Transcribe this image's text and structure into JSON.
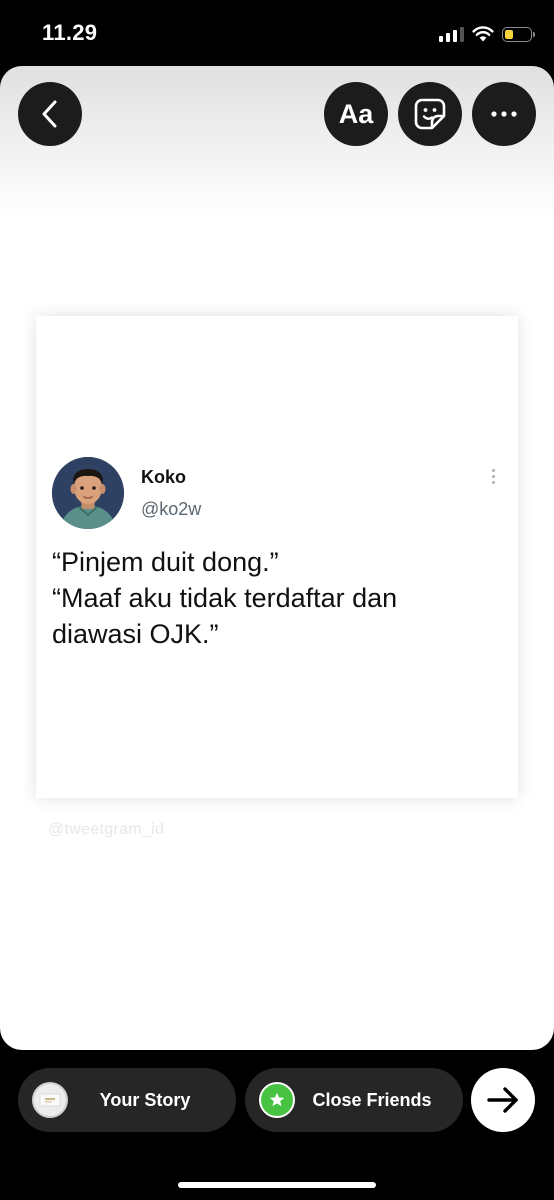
{
  "status_bar": {
    "time": "11.29",
    "signal_bars": 3,
    "signal_total": 4,
    "battery_level": 0.35,
    "battery_color": "#f5d33a"
  },
  "toolbar": {
    "back_icon": "chevron-left-icon",
    "text_label": "Aa",
    "sticker_icon": "sticker-icon",
    "more_icon": "more-horizontal-icon"
  },
  "tweet": {
    "name": "Koko",
    "handle": "@ko2w",
    "lines": [
      "“Pinjem duit dong.”",
      "“Maaf aku tidak terdaftar dan",
      "diawasi OJK.”"
    ]
  },
  "watermark": "@tweetgram_id",
  "share_bar": {
    "your_story_label": "Your Story",
    "close_friends_label": "Close Friends",
    "close_friends_color": "#47c341",
    "send_icon": "arrow-right-icon"
  }
}
